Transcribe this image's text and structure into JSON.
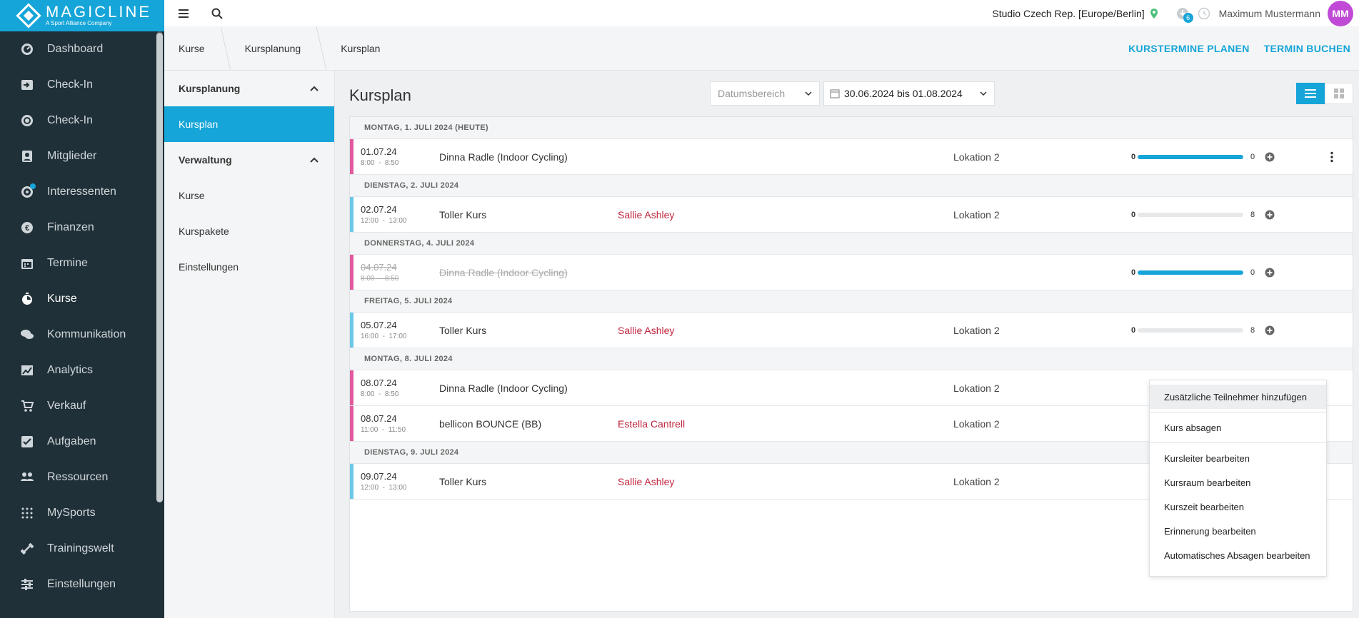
{
  "brand": {
    "name": "MAGICLINE",
    "tagline": "A Sport Alliance Company",
    "accent": "#16a5d8"
  },
  "sidebar": {
    "items": [
      {
        "label": "Dashboard",
        "icon": "dashboard-icon"
      },
      {
        "label": "Check-In",
        "icon": "checkin-arrow-icon"
      },
      {
        "label": "Check-In",
        "icon": "checkin-circle-icon"
      },
      {
        "label": "Mitglieder",
        "icon": "members-icon"
      },
      {
        "label": "Interessenten",
        "icon": "prospects-icon"
      },
      {
        "label": "Finanzen",
        "icon": "finance-icon"
      },
      {
        "label": "Termine",
        "icon": "calendar-icon"
      },
      {
        "label": "Kurse",
        "icon": "courses-icon"
      },
      {
        "label": "Kommunikation",
        "icon": "chat-icon"
      },
      {
        "label": "Analytics",
        "icon": "analytics-icon"
      },
      {
        "label": "Verkauf",
        "icon": "cart-icon"
      },
      {
        "label": "Aufgaben",
        "icon": "tasks-icon"
      },
      {
        "label": "Ressourcen",
        "icon": "resources-icon"
      },
      {
        "label": "MySports",
        "icon": "mysports-icon"
      },
      {
        "label": "Trainingswelt",
        "icon": "dumbbell-icon"
      },
      {
        "label": "Einstellungen",
        "icon": "settings-icon"
      }
    ],
    "active": "Kurse"
  },
  "topbar": {
    "studio": "Studio Czech Rep. [Europe/Berlin]",
    "notification_count": "6",
    "user_name": "Maximum Mustermann",
    "avatar_initials": "MM"
  },
  "breadcrumb": [
    "Kurse",
    "Kursplanung",
    "Kursplan"
  ],
  "actions": {
    "plan": "KURSTERMINE PLANEN",
    "book": "TERMIN BUCHEN"
  },
  "subnav": {
    "group1": "Kursplanung",
    "group1_items": [
      "Kursplan"
    ],
    "group2": "Verwaltung",
    "group2_items": [
      "Kurse",
      "Kurspakete",
      "Einstellungen"
    ]
  },
  "main": {
    "title": "Kursplan",
    "range_placeholder": "Datumsbereich",
    "date_range": "30.06.2024 bis 01.08.2024"
  },
  "schedule": [
    {
      "day": "MONTAG, 1. JULI 2024 (HEUTE)",
      "entries": [
        {
          "date": "01.07.24",
          "time": "8:00  -  8:50",
          "name": "Dinna Radle (Indoor Cycling)",
          "trainer": "",
          "location": "Lokation 2",
          "booked": "0",
          "capacity": "0",
          "fill": 1,
          "color": "#e05a9e",
          "cancelled": false,
          "menu": true
        }
      ]
    },
    {
      "day": "DIENSTAG, 2. JULI 2024",
      "entries": [
        {
          "date": "02.07.24",
          "time": "12:00  -  13:00",
          "name": "Toller Kurs",
          "trainer": "Sallie Ashley",
          "location": "Lokation 2",
          "booked": "0",
          "capacity": "8",
          "fill": 0,
          "color": "#6cc6e8",
          "cancelled": false
        }
      ]
    },
    {
      "day": "DONNERSTAG, 4. JULI 2024",
      "entries": [
        {
          "date": "04.07.24",
          "time": "8:00  -  8:50",
          "name": "Dinna Radle (Indoor Cycling)",
          "trainer": "",
          "location": "",
          "booked": "0",
          "capacity": "0",
          "fill": 1,
          "color": "#e05a9e",
          "cancelled": true
        }
      ]
    },
    {
      "day": "FREITAG, 5. JULI 2024",
      "entries": [
        {
          "date": "05.07.24",
          "time": "16:00  -  17:00",
          "name": "Toller Kurs",
          "trainer": "Sallie Ashley",
          "location": "Lokation 2",
          "booked": "0",
          "capacity": "8",
          "fill": 0,
          "color": "#6cc6e8",
          "cancelled": false
        }
      ]
    },
    {
      "day": "MONTAG, 8. JULI 2024",
      "entries": [
        {
          "date": "08.07.24",
          "time": "8:00  -  8:50",
          "name": "Dinna Radle (Indoor Cycling)",
          "trainer": "",
          "location": "Lokation 2",
          "color": "#e05a9e",
          "cancelled": false,
          "hideCounts": true
        },
        {
          "date": "08.07.24",
          "time": "11:00  -  11:50",
          "name": "bellicon BOUNCE (BB)",
          "trainer": "Estella Cantrell",
          "location": "Lokation 2",
          "color": "#e05a9e",
          "cancelled": false,
          "hideCounts": true
        }
      ]
    },
    {
      "day": "DIENSTAG, 9. JULI 2024",
      "entries": [
        {
          "date": "09.07.24",
          "time": "12:00  -  13:00",
          "name": "Toller Kurs",
          "trainer": "Sallie Ashley",
          "location": "Lokation 2",
          "color": "#6cc6e8",
          "cancelled": false,
          "hideCounts": true
        }
      ]
    }
  ],
  "context_menu": {
    "groups": [
      [
        "Zusätzliche Teilnehmer hinzufügen"
      ],
      [
        "Kurs absagen"
      ],
      [
        "Kursleiter bearbeiten",
        "Kursraum bearbeiten",
        "Kurszeit bearbeiten",
        "Erinnerung bearbeiten",
        "Automatisches Absagen bearbeiten"
      ]
    ]
  }
}
